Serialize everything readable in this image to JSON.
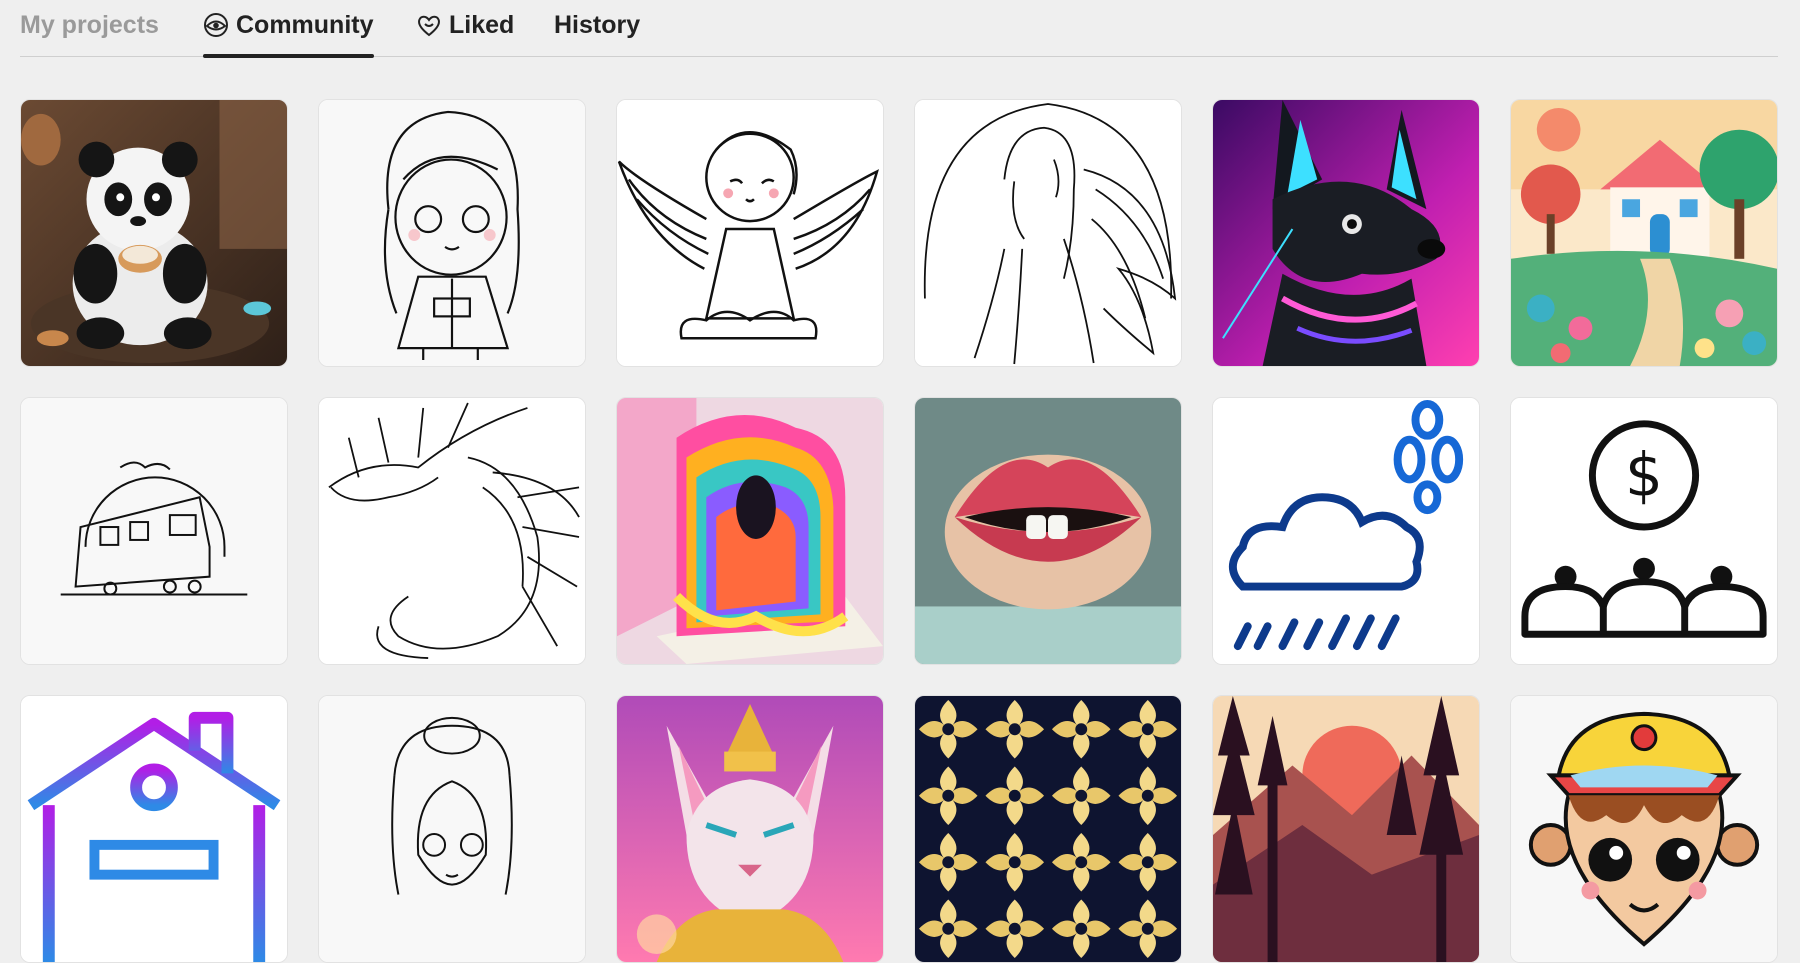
{
  "tabs": [
    {
      "label": "My projects",
      "icon": "",
      "state": "muted"
    },
    {
      "label": "Community",
      "icon": "eye-icon",
      "state": "active"
    },
    {
      "label": "Liked",
      "icon": "heart-icon",
      "state": "normal"
    },
    {
      "label": "History",
      "icon": "",
      "state": "normal"
    }
  ],
  "gallery": {
    "items": [
      {
        "subject": "panda-eating-donut"
      },
      {
        "subject": "chibi-girl-lineart"
      },
      {
        "subject": "angel-lineart"
      },
      {
        "subject": "woman-angel-lineart"
      },
      {
        "subject": "neon-cyber-dog"
      },
      {
        "subject": "cottage-garden"
      },
      {
        "subject": "train-lineart"
      },
      {
        "subject": "dragon-lineart"
      },
      {
        "subject": "rainbow-paint-sculpture"
      },
      {
        "subject": "lips-teeth"
      },
      {
        "subject": "rain-cloud-icon"
      },
      {
        "subject": "dollar-people-icon"
      },
      {
        "subject": "house-icon"
      },
      {
        "subject": "princess-lineart"
      },
      {
        "subject": "golden-sphinx-cat"
      },
      {
        "subject": "ornamental-pattern"
      },
      {
        "subject": "forest-sunset"
      },
      {
        "subject": "cartoon-boy-cap"
      }
    ]
  },
  "colors": {
    "accent": "#222222",
    "muted": "#9a9a9a",
    "background": "#efefef"
  }
}
